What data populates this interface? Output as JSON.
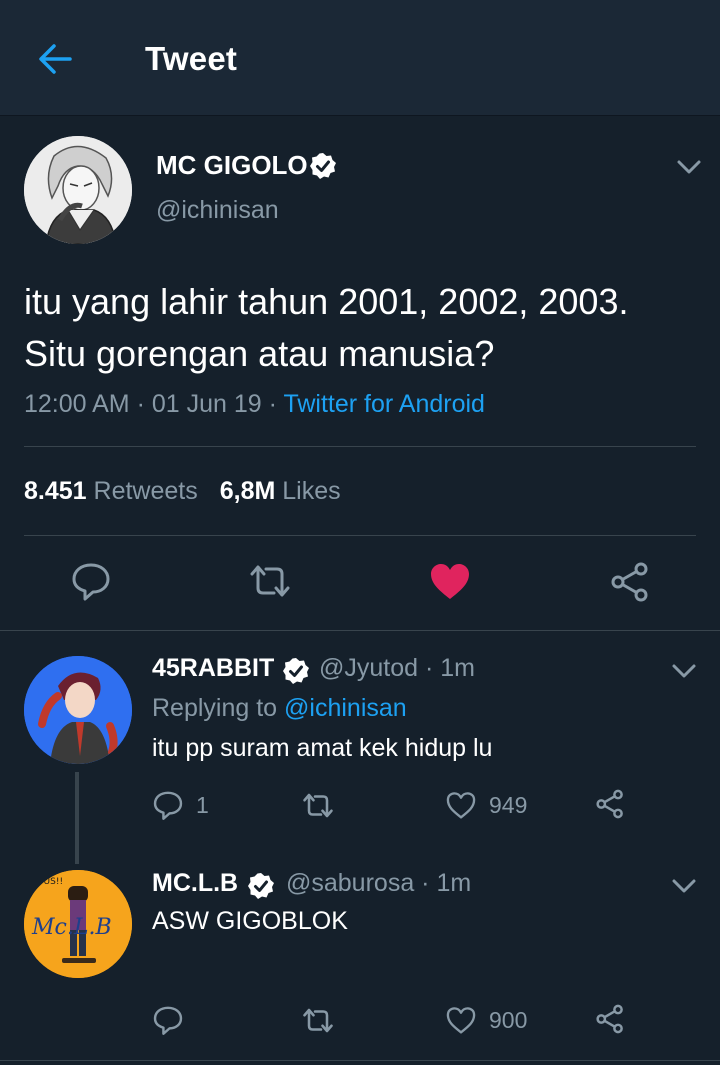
{
  "header": {
    "title": "Tweet",
    "back_icon": "arrow-left-icon",
    "accent": "#1da1f2"
  },
  "tweet": {
    "name": "MC GIGOLO",
    "handle": "@ichinisan",
    "text_line1": "itu yang lahir tahun 2001, 2002, 2003.",
    "text_line2": "Situ gorengan atau manusia?",
    "time": "12:00 AM",
    "date": "01 Jun 19",
    "source": "Twitter for Android",
    "retweets_count": "8.451",
    "retweets_label": "Retweets",
    "likes_count": "6,8M",
    "likes_label": "Likes",
    "liked": true,
    "like_color": "#e0245e"
  },
  "replies": [
    {
      "name": "45RABBIT",
      "handle": "@Jyutod",
      "time": "1m",
      "replying_label": "Replying to",
      "replying_to": "@ichinisan",
      "text": "itu pp suram amat kek hidup lu",
      "reply_count": "1",
      "like_count": "949"
    },
    {
      "name": "MC.L.B",
      "handle": "@saburosa",
      "time": "1m",
      "text": "ASW GIGOBLOK",
      "like_count": "900",
      "avatar_text_top": "#US!!",
      "avatar_text_logo": "Mc.L.B"
    }
  ]
}
